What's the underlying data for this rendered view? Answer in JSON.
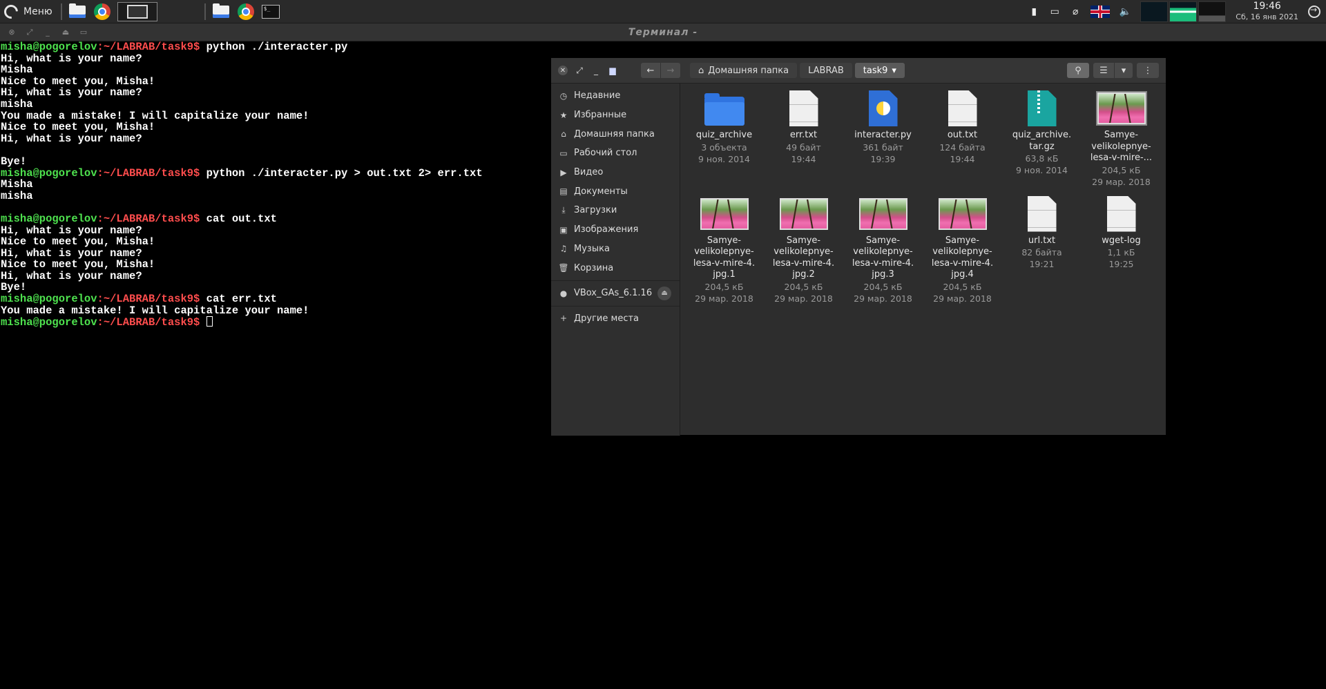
{
  "panel": {
    "menu_label": "Меню",
    "time": "19:46",
    "date": "Сб, 16 янв 2021"
  },
  "terminal": {
    "title": "Терминал -",
    "prompt_user": "misha@pogorelov",
    "prompt_path": ":~/LABRAB/task9$",
    "lines": [
      {
        "p": true,
        "cmd": " python ./interacter.py"
      },
      {
        "t": "Hi, what is your name?"
      },
      {
        "t": "Misha"
      },
      {
        "t": "Nice to meet you, Misha!"
      },
      {
        "t": "Hi, what is your name?"
      },
      {
        "t": "misha"
      },
      {
        "t": "You made a mistake! I will capitalize your name!"
      },
      {
        "t": "Nice to meet you, Misha!"
      },
      {
        "t": "Hi, what is your name?"
      },
      {
        "t": ""
      },
      {
        "t": "Bye!"
      },
      {
        "p": true,
        "cmd": " python ./interacter.py > out.txt 2> err.txt"
      },
      {
        "t": "Misha"
      },
      {
        "t": "misha"
      },
      {
        "t": ""
      },
      {
        "p": true,
        "cmd": " cat out.txt"
      },
      {
        "t": "Hi, what is your name?"
      },
      {
        "t": "Nice to meet you, Misha!"
      },
      {
        "t": "Hi, what is your name?"
      },
      {
        "t": "Nice to meet you, Misha!"
      },
      {
        "t": "Hi, what is your name?"
      },
      {
        "t": "Bye!"
      },
      {
        "p": true,
        "cmd": " cat err.txt"
      },
      {
        "t": "You made a mistake! I will capitalize your name!"
      },
      {
        "p": true,
        "cmd": " ",
        "cursor": true
      }
    ]
  },
  "file_manager": {
    "breadcrumbs": [
      "Домашняя папка",
      "LABRAB",
      "task9"
    ],
    "sidebar": [
      {
        "label": "Недавние",
        "icon": "clock-icon",
        "glyph": "◷"
      },
      {
        "label": "Избранные",
        "icon": "star-icon",
        "glyph": "★"
      },
      {
        "label": "Домашняя папка",
        "icon": "home-icon",
        "glyph": "⌂"
      },
      {
        "label": "Рабочий стол",
        "icon": "desktop-icon",
        "glyph": "▭"
      },
      {
        "label": "Видео",
        "icon": "video-icon",
        "glyph": "▶"
      },
      {
        "label": "Документы",
        "icon": "document-icon",
        "glyph": "▤"
      },
      {
        "label": "Загрузки",
        "icon": "download-icon",
        "glyph": "⤓"
      },
      {
        "label": "Изображения",
        "icon": "image-icon",
        "glyph": "▣"
      },
      {
        "label": "Музыка",
        "icon": "music-icon",
        "glyph": "♫"
      },
      {
        "label": "Корзина",
        "icon": "trash-icon",
        "glyph": "🗑"
      }
    ],
    "devices": [
      {
        "label": "VBox_GAs_6.1.16",
        "icon": "disc-icon",
        "glyph": "●"
      }
    ],
    "other_places": {
      "label": "Другие места",
      "glyph": "+"
    },
    "files": [
      {
        "name": "quiz_archive",
        "meta1": "3 объекта",
        "meta2": "9 ноя. 2014",
        "kind": "folder"
      },
      {
        "name": "err.txt",
        "meta1": "49 байт",
        "meta2": "19:44",
        "kind": "doc"
      },
      {
        "name": "interacter.py",
        "meta1": "361 байт",
        "meta2": "19:39",
        "kind": "py"
      },
      {
        "name": "out.txt",
        "meta1": "124 байта",
        "meta2": "19:44",
        "kind": "doc"
      },
      {
        "name": "quiz_archive.\ntar.gz",
        "meta1": "63,8 кБ",
        "meta2": "9 ноя. 2014",
        "kind": "zip"
      },
      {
        "name": "Samye-\nvelikolepnye-\nlesa-v-mire-...",
        "meta1": "204,5 кБ",
        "meta2": "29 мар. 2018",
        "kind": "img"
      },
      {
        "name": "Samye-\nvelikolepnye-\nlesa-v-mire-4.\njpg.1",
        "meta1": "204,5 кБ",
        "meta2": "29 мар. 2018",
        "kind": "img"
      },
      {
        "name": "Samye-\nvelikolepnye-\nlesa-v-mire-4.\njpg.2",
        "meta1": "204,5 кБ",
        "meta2": "29 мар. 2018",
        "kind": "img"
      },
      {
        "name": "Samye-\nvelikolepnye-\nlesa-v-mire-4.\njpg.3",
        "meta1": "204,5 кБ",
        "meta2": "29 мар. 2018",
        "kind": "img"
      },
      {
        "name": "Samye-\nvelikolepnye-\nlesa-v-mire-4.\njpg.4",
        "meta1": "204,5 кБ",
        "meta2": "29 мар. 2018",
        "kind": "img"
      },
      {
        "name": "url.txt",
        "meta1": "82 байта",
        "meta2": "19:21",
        "kind": "doc"
      },
      {
        "name": "wget-log",
        "meta1": "1,1 кБ",
        "meta2": "19:25",
        "kind": "doc"
      }
    ]
  }
}
